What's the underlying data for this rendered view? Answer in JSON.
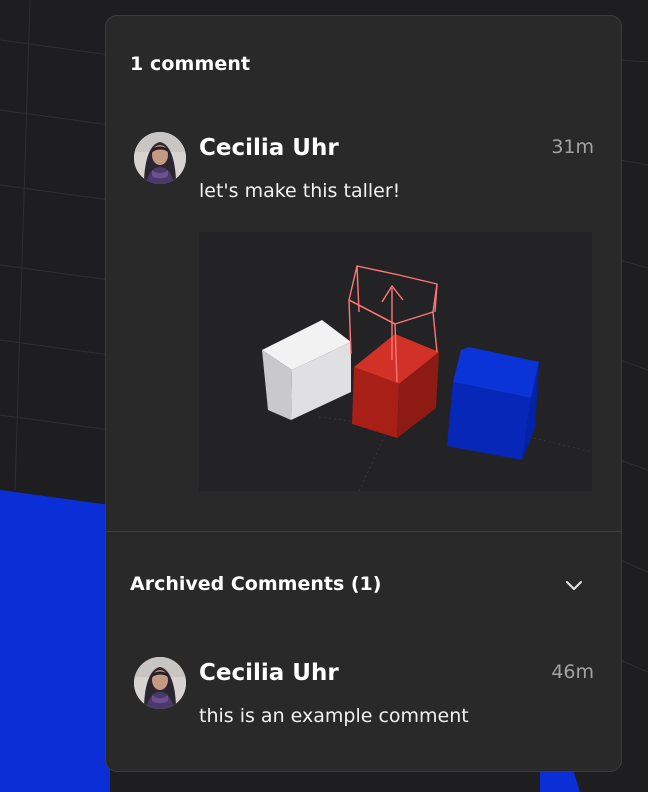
{
  "panel": {
    "title": "1 comment",
    "comments": [
      {
        "author": "Cecilia Uhr",
        "time": "31m",
        "body": "let's make this taller!"
      }
    ],
    "archived": {
      "title": "Archived Comments (1)",
      "comments": [
        {
          "author": "Cecilia Uhr",
          "time": "46m",
          "body": "this is an example comment"
        }
      ]
    }
  },
  "colors": {
    "panel_bg": "#292929",
    "canvas_bg": "#1e1e21",
    "blue_plane": "#0a2fd6",
    "sketch_red": "#ff6f6f"
  },
  "icons": {
    "archived_toggle": "chevron-down-icon",
    "avatar": "user-avatar"
  }
}
